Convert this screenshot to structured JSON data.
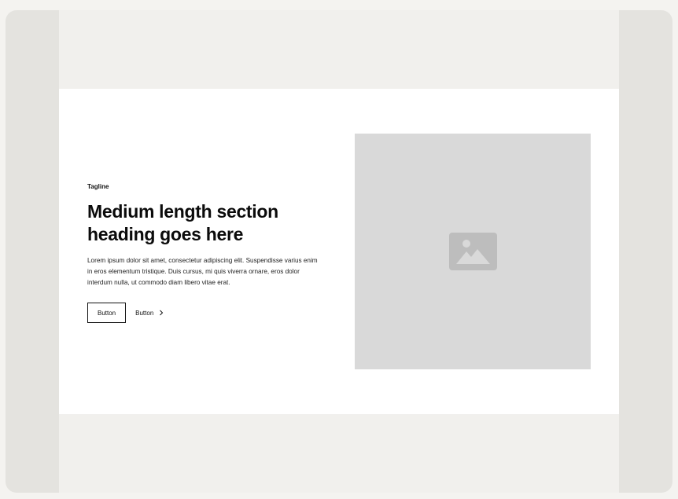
{
  "hero": {
    "tagline": "Tagline",
    "heading": "Medium length section heading goes here",
    "body": "Lorem ipsum dolor sit amet, consectetur adipiscing elit. Suspendisse varius enim in eros elementum tristique. Duis cursus, mi quis viverra ornare, eros dolor interdum nulla, ut commodo diam libero vitae erat.",
    "primary_button_label": "Button",
    "secondary_button_label": "Button",
    "secondary_button_icon": "chevron-right-icon",
    "image_icon": "image-placeholder-icon"
  },
  "colors": {
    "page_background": "#f4f3f0",
    "frame_background": "#e4e3df",
    "canvas_background": "#f1f0ed",
    "section_background": "#ffffff",
    "image_placeholder": "#d9d9d9",
    "image_icon": "#bdbdbd",
    "text": "#111111"
  }
}
